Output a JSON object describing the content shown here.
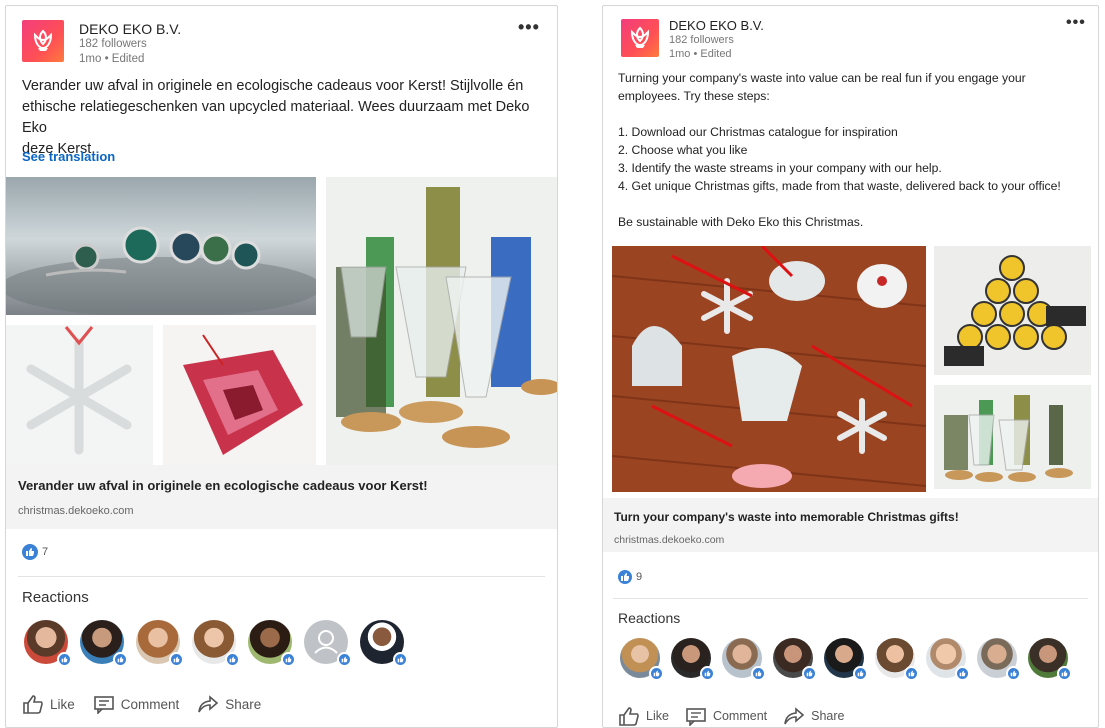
{
  "posts": [
    {
      "company": "DEKO EKO B.V.",
      "followers": "182 followers",
      "time": "1mo • Edited",
      "more": "•••",
      "text_lines": [
        "Verander uw afval in originele en ecologische cadeaus voor Kerst! Stijlvolle én",
        "ethische relatiegeschenken van upcycled materiaal. Wees duurzaam met Deko Eko",
        "deze Kerst."
      ],
      "see_translation": "See translation",
      "link_title": "Verander uw afval in originele en ecologische cadeaus voor Kerst!",
      "link_url": "christmas.dekoeko.com",
      "like_count": "7",
      "reactions_label": "Reactions",
      "actions": {
        "like": "Like",
        "comment": "Comment",
        "share": "Share"
      }
    },
    {
      "company": "DEKO EKO B.V.",
      "followers": "182 followers",
      "time": "1mo • Edited",
      "more": "•••",
      "text_lines": [
        "Turning your company's waste into value can be real fun if you engage your",
        "employees. Try these steps:",
        "",
        "1. Download our Christmas catalogue for inspiration",
        "2. Choose what you like",
        "3. Identify the waste streams in your company with our help.",
        "4. Get unique Christmas gifts, made from that waste, delivered back to your office!",
        "",
        "Be sustainable with Deko Eko this Christmas."
      ],
      "link_title": "Turn your company's waste into memorable Christmas gifts!",
      "link_url": "christmas.dekoeko.com",
      "like_count": "9",
      "reactions_label": "Reactions",
      "actions": {
        "like": "Like",
        "comment": "Comment",
        "share": "Share"
      }
    }
  ]
}
